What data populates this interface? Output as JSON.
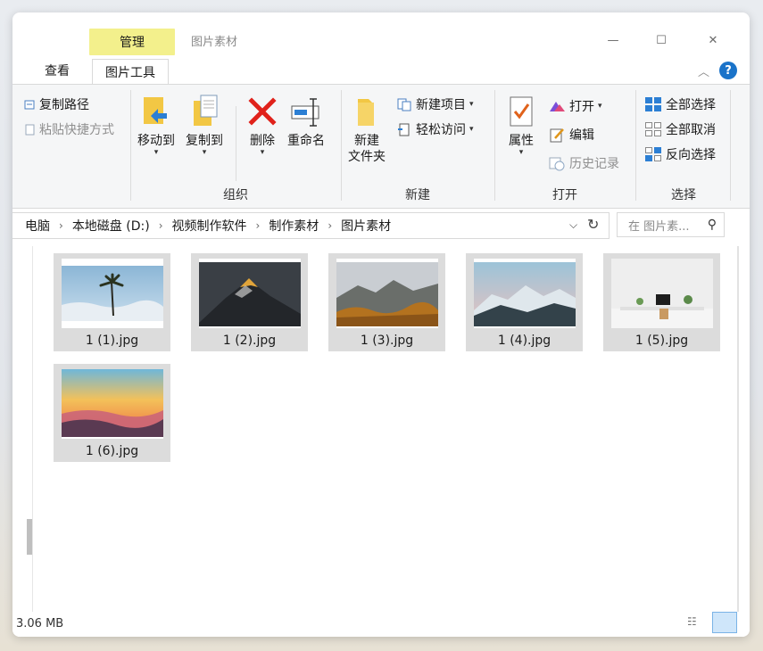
{
  "window": {
    "title": "图片素材",
    "context_tab": "管理",
    "controls": {
      "minimize": "—",
      "maximize": "☐",
      "close": "✕"
    },
    "help": "?"
  },
  "tabs": [
    {
      "label": "查看",
      "active": false
    },
    {
      "label": "图片工具",
      "active": true
    }
  ],
  "ribbon": {
    "clipboard": {
      "copy_path": "复制路径",
      "paste_shortcut": "粘贴快捷方式"
    },
    "organize": {
      "label": "组织",
      "move_to": "移动到",
      "copy_to": "复制到",
      "delete": "删除",
      "rename": "重命名"
    },
    "new": {
      "label": "新建",
      "new_folder_line1": "新建",
      "new_folder_line2": "文件夹",
      "new_item": "新建项目",
      "easy_access": "轻松访问"
    },
    "open": {
      "label": "打开",
      "properties": "属性",
      "open": "打开",
      "edit": "编辑",
      "history": "历史记录"
    },
    "select": {
      "label": "选择",
      "select_all": "全部选择",
      "select_none": "全部取消",
      "invert": "反向选择"
    }
  },
  "address": {
    "crumbs": [
      "电脑",
      "本地磁盘 (D:)",
      "视频制作软件",
      "制作素材",
      "图片素材"
    ]
  },
  "search": {
    "placeholder": "在 图片素..."
  },
  "files": [
    {
      "name": "1 (1).jpg"
    },
    {
      "name": "1 (2).jpg"
    },
    {
      "name": "1 (3).jpg"
    },
    {
      "name": "1 (4).jpg"
    },
    {
      "name": "1 (5).jpg"
    },
    {
      "name": "1 (6).jpg"
    }
  ],
  "status": {
    "text": "3.06 MB"
  },
  "colors": {
    "manage_tab": "#f3f08c",
    "accent": "#1a73c9",
    "selection": "#dcdcdc"
  }
}
